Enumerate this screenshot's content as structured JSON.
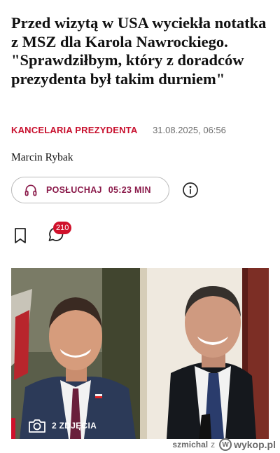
{
  "article": {
    "headline": "Przed wizytą w USA wyciekła notatka z MSZ dla Karola Nawrockiego. \"Sprawdziłbym, który z doradców prezydenta był takim durniem\"",
    "category": "KANCELARIA PREZYDENTA",
    "date": "31.08.2025, 06:56",
    "author": "Marcin Rybak"
  },
  "audio": {
    "label": "POSŁUCHAJ",
    "duration": "05:23 MIN"
  },
  "actions": {
    "comment_count": "210"
  },
  "photo": {
    "count_label": "2 ZDJĘCIA"
  },
  "watermark": {
    "user": "szmichal",
    "joiner": "z",
    "site": "wykop.pl"
  },
  "colors": {
    "accent_red": "#c8102e",
    "badge_red": "#d0112b",
    "audio_purple": "#8a1a4a"
  },
  "icons": [
    "headphones-icon",
    "info-icon",
    "bookmark-icon",
    "comment-icon",
    "camera-icon",
    "wykop-logo-icon"
  ]
}
